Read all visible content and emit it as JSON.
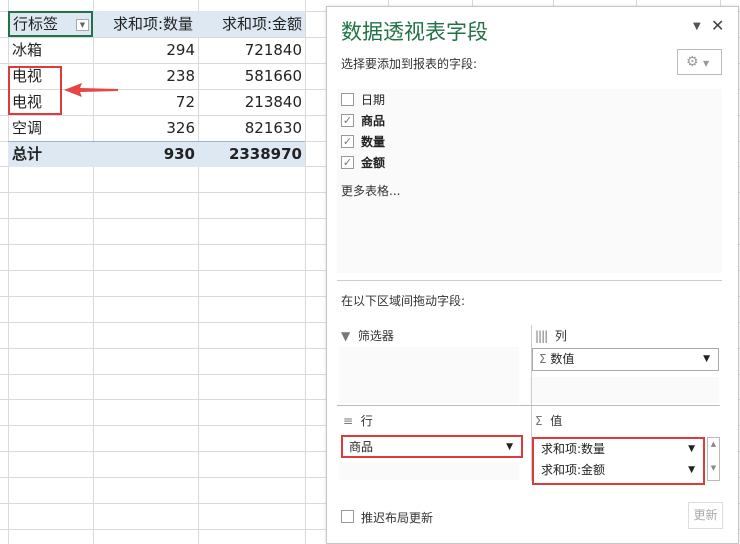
{
  "pivot": {
    "headers": [
      "行标签",
      "求和项:数量",
      "求和项:金额"
    ],
    "rows": [
      [
        "冰箱",
        "294",
        "721840"
      ],
      [
        "电视",
        "238",
        "581660"
      ],
      [
        "电视",
        "72",
        "213840"
      ],
      [
        "空调",
        "326",
        "821630"
      ]
    ],
    "total": [
      "总计",
      "930",
      "2338970"
    ]
  },
  "panel": {
    "title": "数据透视表字段",
    "choose_label": "选择要添加到报表的字段:",
    "fields": [
      {
        "label": "日期",
        "checked": false
      },
      {
        "label": "商品",
        "checked": true
      },
      {
        "label": "数量",
        "checked": true
      },
      {
        "label": "金额",
        "checked": true
      }
    ],
    "more_tables": "更多表格...",
    "drag_label": "在以下区域间拖动字段:",
    "filter_label": "筛选器",
    "columns_label": "列",
    "columns_item": "数值",
    "rows_label": "行",
    "rows_item": "商品",
    "values_label": "值",
    "values_items": [
      "求和项:数量",
      "求和项:金额"
    ],
    "defer_label": "推迟布局更新",
    "update_label": "更新",
    "check": "✓"
  },
  "colors": {
    "accent": "#217346",
    "highlight": "#e03a3a",
    "header_bg": "#dde8f3"
  }
}
